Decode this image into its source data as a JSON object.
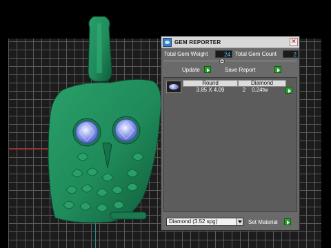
{
  "panel": {
    "title": "GEM REPORTER",
    "close_glyph": "×",
    "icon": "gem-reporter-icon",
    "total_gem_weight_label": "Total Gem Weight",
    "total_gem_weight_value": "24",
    "total_gem_count_label": "Total Gem Count",
    "total_gem_count_value": "2",
    "update_label": "Update",
    "save_report_label": "Save Report",
    "gem_list": {
      "columns": [
        "Round",
        "Diamond"
      ],
      "rows": [
        {
          "size": "3.85 X 4.09",
          "count": "2",
          "weight": "0.24tw"
        }
      ]
    },
    "material_select_value": "Diamond    (3.52 spg)",
    "set_material_label": "Set Material"
  },
  "colors": {
    "viewport_bg": "#1c1c1c",
    "grid": "#5a5a5a",
    "owl_green": "#1f8a5a",
    "accent_green": "#2aa02a",
    "value_text": "#4ec8ff"
  }
}
